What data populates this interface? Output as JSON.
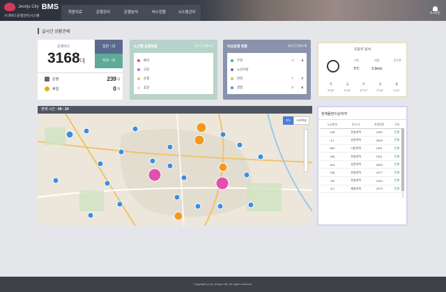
{
  "app": {
    "city_mark": "Jeonju City",
    "title": "BMS",
    "subtitle": "시내버스운행관리시스템"
  },
  "nav": [
    "최종자료",
    "운행관리",
    "운행분석",
    "버스현황",
    "시스템관리"
  ],
  "user": {
    "label": "로그아웃"
  },
  "page_title": "실시간 상황관제",
  "summary": {
    "total_label": "운행버스",
    "total_value": "3168",
    "total_unit": "대",
    "btn_normal": "일반 : 대",
    "btn_low": "저상 : 대",
    "running_label": "운행",
    "running_value": "239",
    "running_unit": "대",
    "idle_label": "휴일",
    "idle_value": "0",
    "idle_unit": "대"
  },
  "route_panel": {
    "title": "노선별 운행현황",
    "meta": "실시간  운행노선",
    "items": [
      {
        "label": "배차",
        "color": "#e24a6b",
        "n1": "",
        "n2": ""
      },
      {
        "label": "고장",
        "color": "#a57ac7",
        "n1": "",
        "n2": ""
      },
      {
        "label": "운행",
        "color": "#e0c23a",
        "n1": "",
        "n2": ""
      },
      {
        "label": "휴일",
        "color": "#dddddd",
        "n1": "",
        "n2": ""
      }
    ]
  },
  "anomaly_panel": {
    "title": "이상운행 현황",
    "meta": "실시간  당일누계",
    "items": [
      {
        "label": "무정",
        "color": "#3ab2a0",
        "n1": "4",
        "n2": "4"
      },
      {
        "label": "노선이탈",
        "color": "#6b6f9c",
        "n1": "",
        "n2": ""
      },
      {
        "label": "연착",
        "color": "#e0c23a",
        "n1": "7",
        "n2": "7"
      },
      {
        "label": "결행",
        "color": "#3c8ee0",
        "n1": "0",
        "n2": "0"
      }
    ]
  },
  "weather": {
    "title": "오늘의 날씨",
    "heads": [
      "기온",
      "바람",
      "강수량"
    ],
    "values": [
      "5℃",
      "0.9m/s",
      ""
    ],
    "forecast_heads": [
      "목",
      "금",
      "토",
      "일",
      "월"
    ],
    "forecast_values": [
      "3˚/18˚",
      "4˚/19˚",
      "11˚/17˚",
      "4˚/10˚",
      "1˚/11˚"
    ]
  },
  "map": {
    "time_label": "현재 시간 :",
    "time_value": "09 : 24",
    "ctl_map": "지도",
    "ctl_sky": "스카이뷰"
  },
  "side_table": {
    "title": "현재돌방이상여객",
    "headers": [
      "노선번호",
      "운수사",
      "차량번호",
      "구분"
    ],
    "rows": [
      [
        "108",
        "전일여객",
        "1302",
        "운행"
      ],
      [
        "3-1",
        "성진여객",
        "2009",
        "운행"
      ],
      [
        "684",
        "시민여객",
        "1301",
        "운행"
      ],
      [
        "165",
        "전일여객",
        "1321",
        "운행"
      ],
      [
        "814",
        "성진여객",
        "2004",
        "운행"
      ],
      [
        "108",
        "전일여객",
        "1377",
        "운행"
      ],
      [
        "752",
        "전일여객",
        "1343",
        "운행"
      ],
      [
        "3-2",
        "제일여객",
        "1573",
        "운행"
      ]
    ]
  },
  "footer": "Copyright (c) by Jeonju City. All rights reserved."
}
